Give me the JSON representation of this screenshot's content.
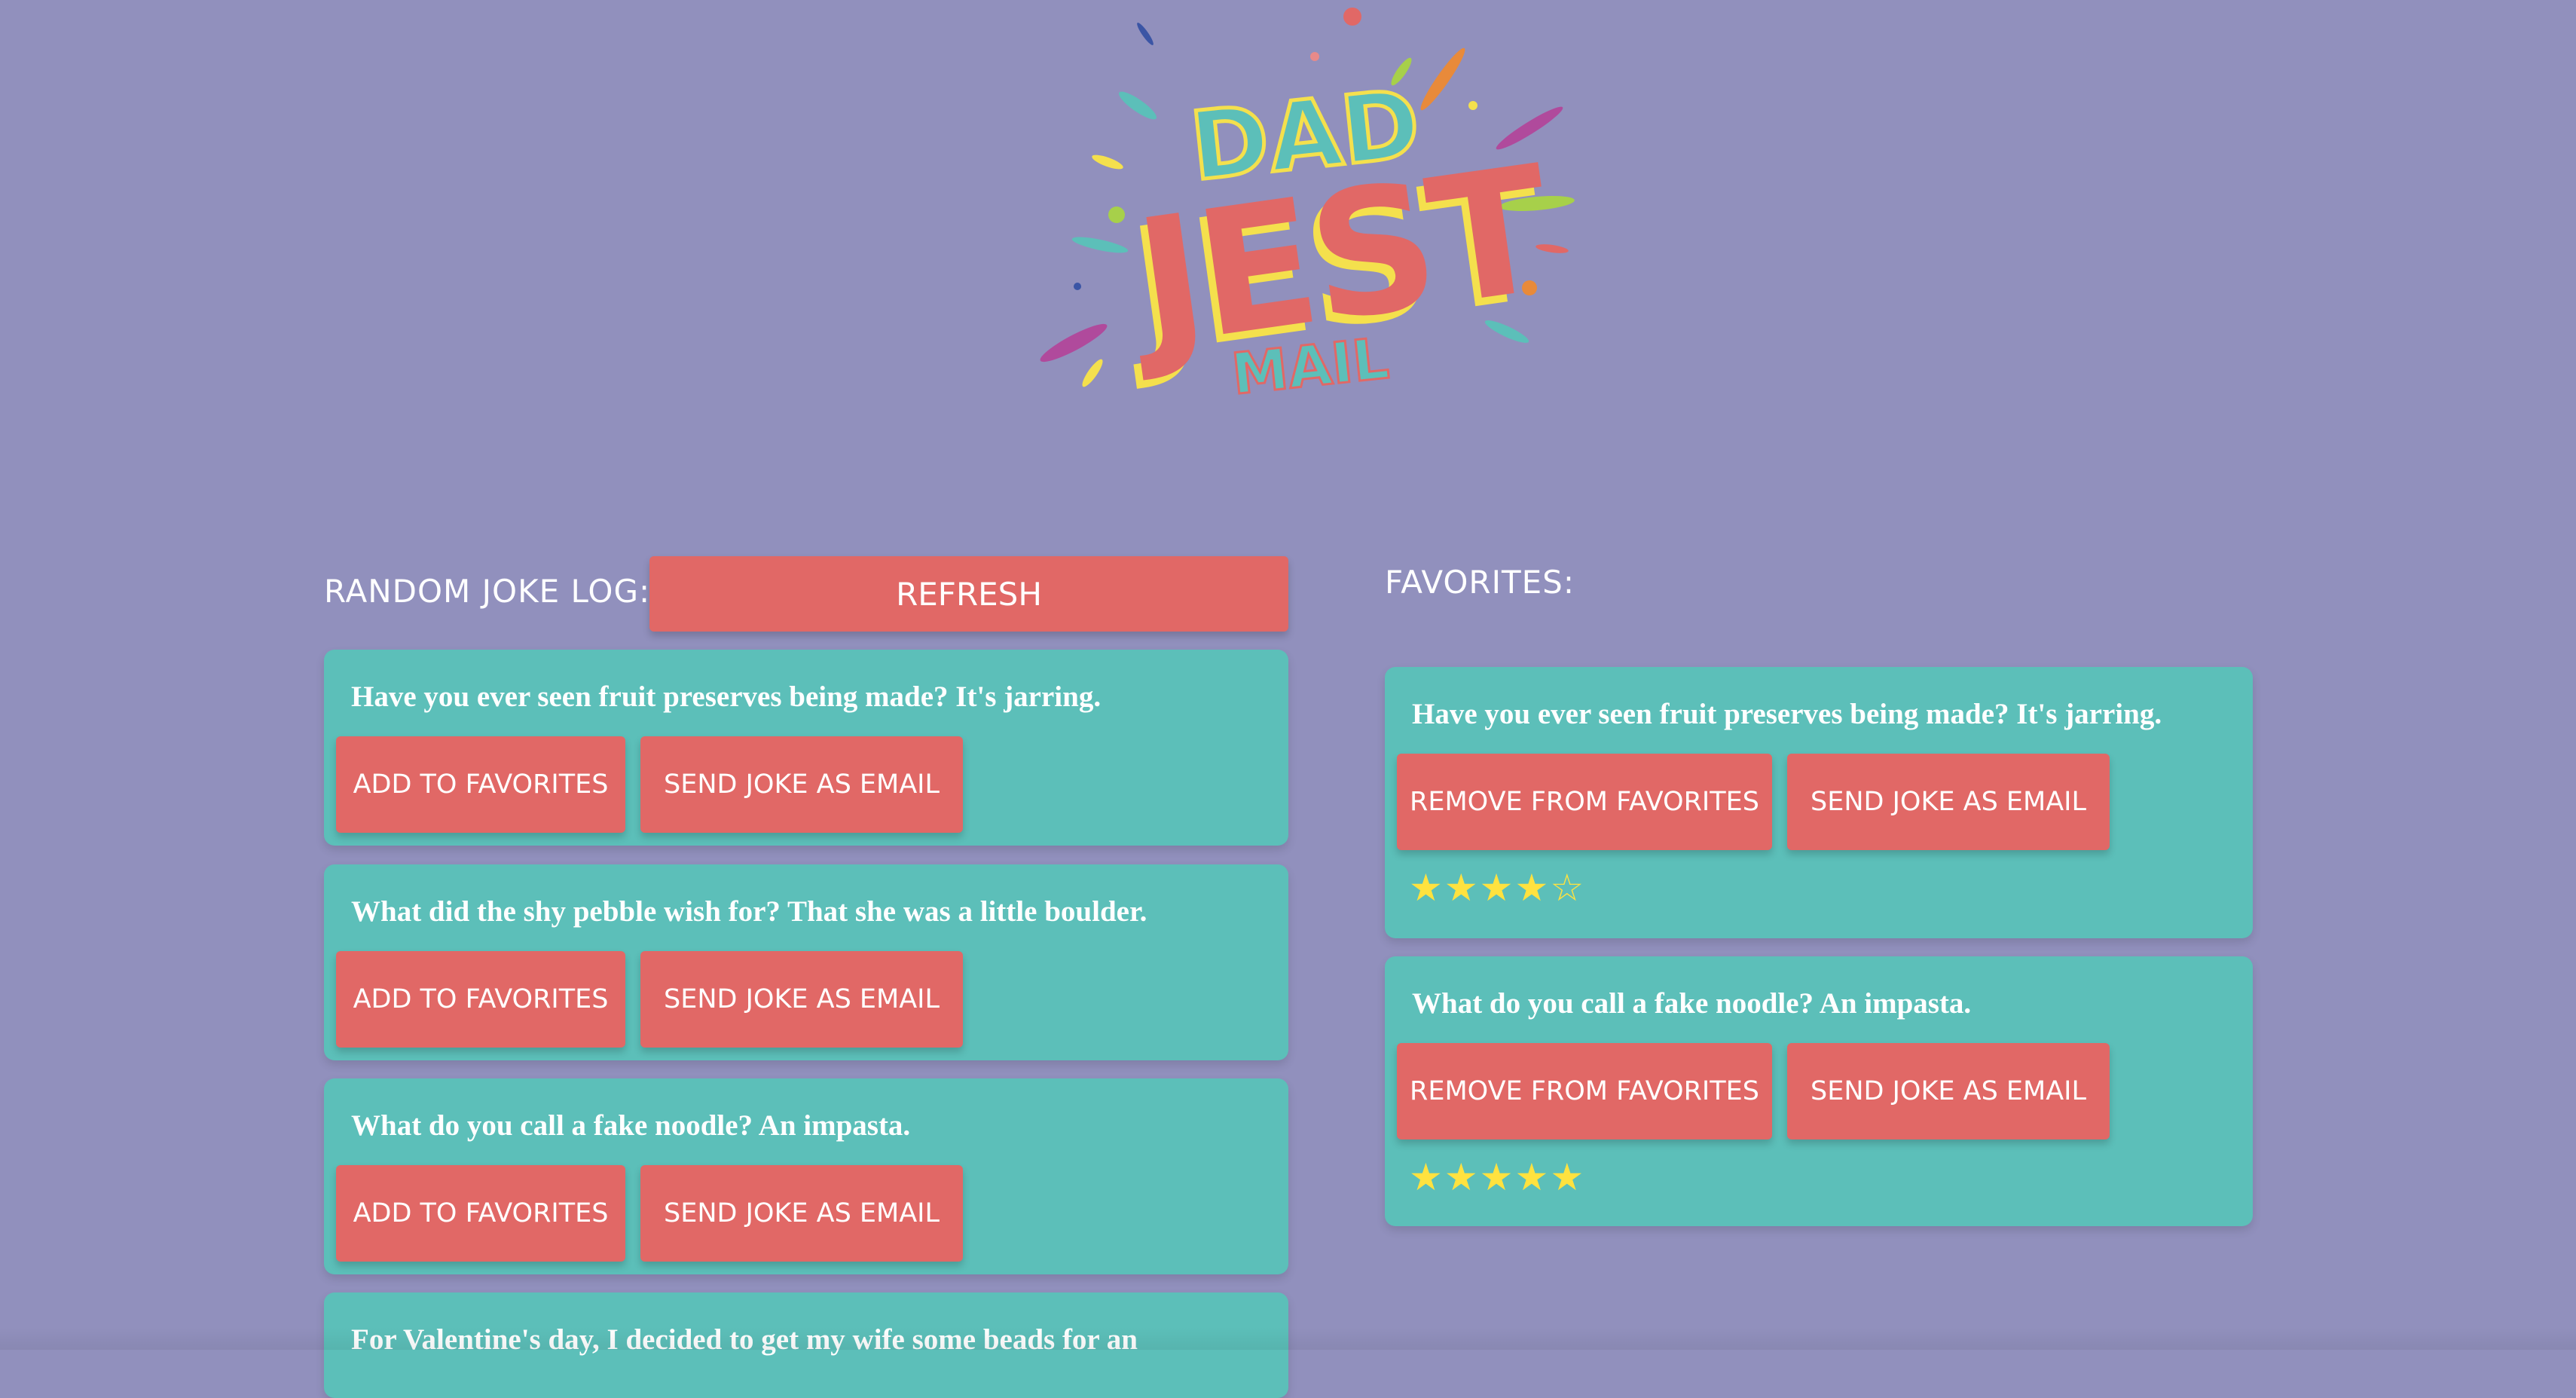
{
  "logo": {
    "line1": "DAD",
    "line2": "JEST",
    "line3": "MAIL"
  },
  "log": {
    "label": "RANDOM JOKE LOG:",
    "refresh_label": "REFRESH",
    "items": [
      {
        "text": "Have you ever seen fruit preserves being made? It's jarring.",
        "fav_label": "ADD TO FAVORITES",
        "email_label": "SEND JOKE AS EMAIL"
      },
      {
        "text": "What did the shy pebble wish for? That she was a little boulder.",
        "fav_label": "ADD TO FAVORITES",
        "email_label": "SEND JOKE AS EMAIL"
      },
      {
        "text": "What do you call a fake noodle? An impasta.",
        "fav_label": "ADD TO FAVORITES",
        "email_label": "SEND JOKE AS EMAIL"
      },
      {
        "text": "For Valentine's day, I decided to get my wife some beads for an"
      }
    ]
  },
  "favorites": {
    "label": "FAVORITES:",
    "items": [
      {
        "text": "Have you ever seen fruit preserves being made? It's jarring.",
        "remove_label": "REMOVE FROM FAVORITES",
        "email_label": "SEND JOKE AS EMAIL",
        "rating": 4,
        "max_rating": 5
      },
      {
        "text": "What do you call a fake noodle? An impasta.",
        "remove_label": "REMOVE FROM FAVORITES",
        "email_label": "SEND JOKE AS EMAIL",
        "rating": 5,
        "max_rating": 5
      }
    ]
  },
  "colors": {
    "background": "#9190bd",
    "card": "#5cbfb9",
    "button": "#e16866",
    "star": "#ffe23f",
    "logo_yellow": "#f4e04d",
    "logo_teal": "#5cbfb9",
    "logo_red": "#e16866"
  }
}
